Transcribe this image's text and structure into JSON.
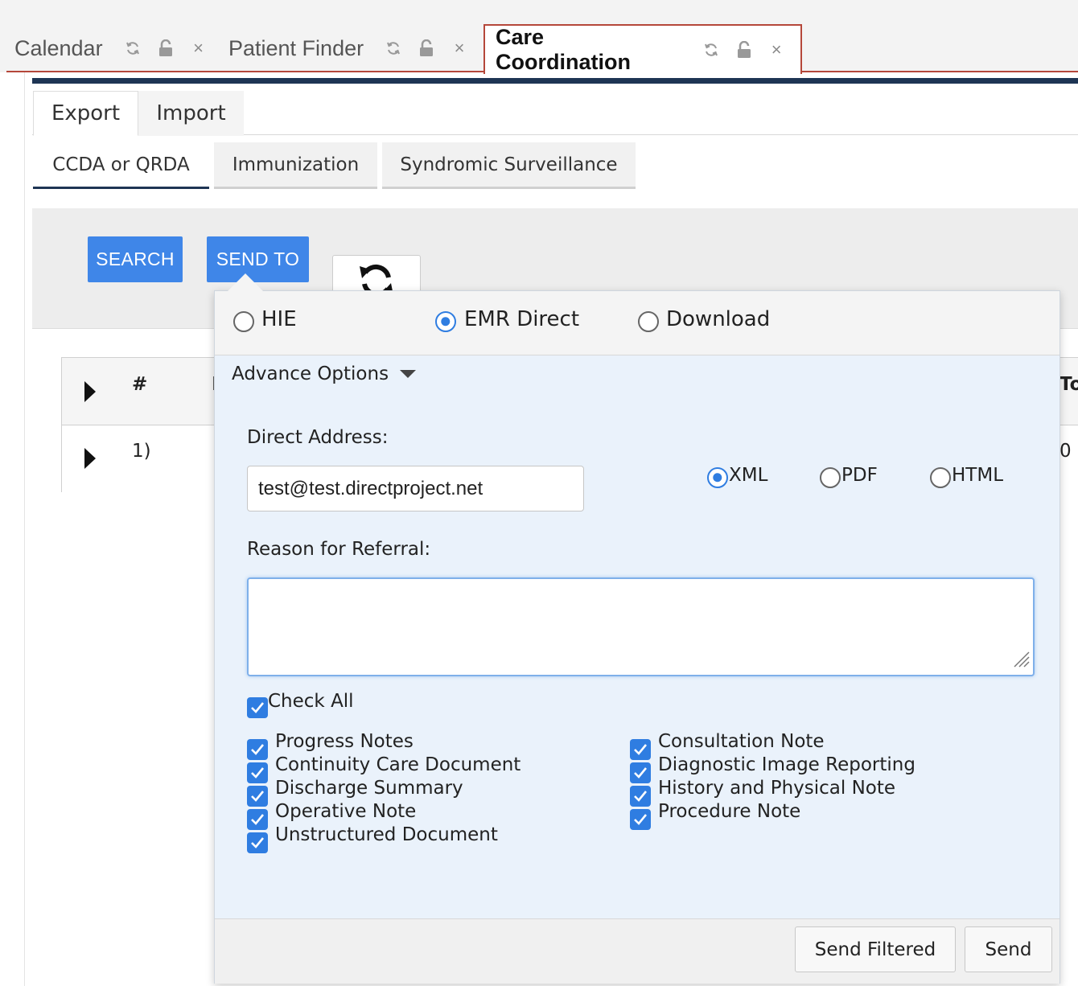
{
  "window_tabs": [
    {
      "label": "Calendar"
    },
    {
      "label": "Patient Finder"
    },
    {
      "label": "Care Coordination"
    }
  ],
  "main_tabs": {
    "export": "Export",
    "import": "Import"
  },
  "sub_tabs": {
    "ccda": "CCDA or QRDA",
    "immunization": "Immunization",
    "syndromic": "Syndromic Surveillance"
  },
  "toolbar": {
    "search": "SEARCH",
    "send_to": "SEND TO"
  },
  "table": {
    "header_hash": "#",
    "header_partial_right": "To",
    "header_partial_left": "I",
    "row_index": "1)",
    "row_partial_right": "0"
  },
  "send_to": {
    "destinations": {
      "hie": "HIE",
      "emr_direct": "EMR Direct",
      "download": "Download",
      "selected": "EMR Direct"
    },
    "advance_options_label": "Advance Options",
    "direct_address_label": "Direct Address:",
    "direct_address_value": "test@test.directproject.net",
    "formats": {
      "xml": "XML",
      "pdf": "PDF",
      "html": "HTML",
      "selected": "XML"
    },
    "reason_label": "Reason for Referral:",
    "reason_value": "",
    "check_all_label": "Check All",
    "doc_types_left": [
      "Progress Notes",
      "Continuity Care Document",
      "Discharge Summary",
      "Operative Note",
      "Unstructured Document"
    ],
    "doc_types_right": [
      "Consultation Note",
      "Diagnostic Image Reporting",
      "History and Physical Note",
      "Procedure Note"
    ],
    "buttons": {
      "send_filtered": "Send Filtered",
      "send": "Send"
    }
  },
  "colors": {
    "accent_blue": "#3f86e8",
    "navy": "#1e3554",
    "tab_border": "#b5473a",
    "popover_bg": "#eaf2fb"
  }
}
